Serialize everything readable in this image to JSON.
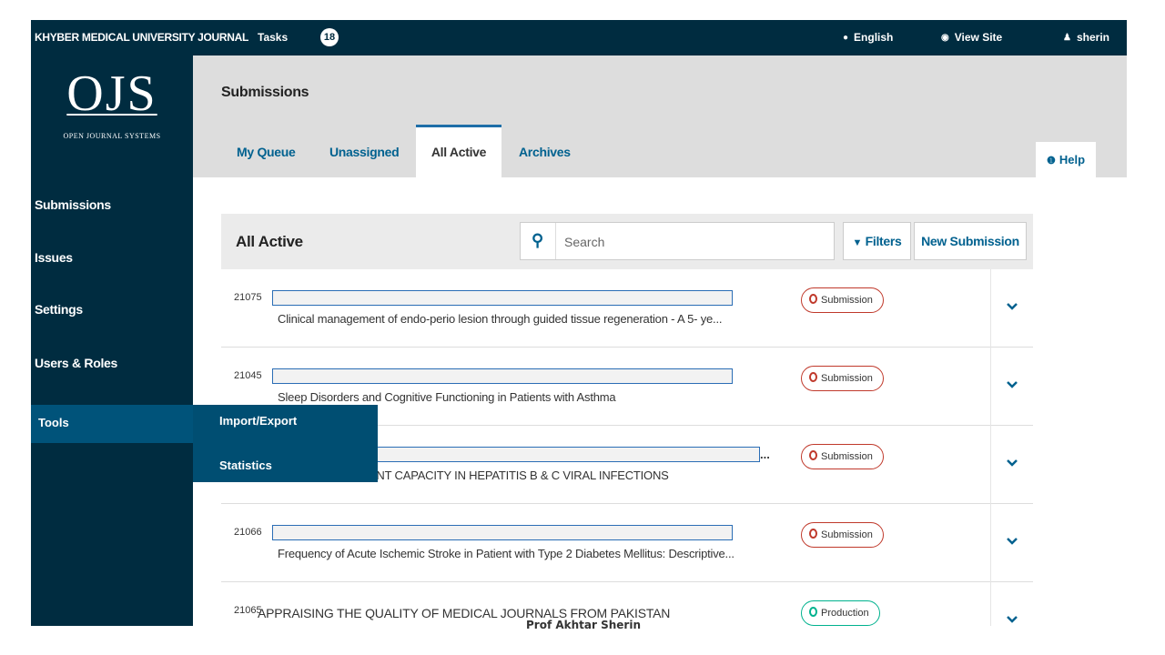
{
  "topbar": {
    "journal": "KHYBER MEDICAL UNIVERSITY JOURNAL",
    "tasks_label": "Tasks",
    "tasks_count": "18",
    "language": "English",
    "view_site": "View Site",
    "user": "sherin"
  },
  "logo": {
    "mark": "OJS",
    "subtitle": "OPEN JOURNAL SYSTEMS"
  },
  "sidebar": {
    "items": [
      {
        "label": "Submissions"
      },
      {
        "label": "Issues"
      },
      {
        "label": "Settings"
      },
      {
        "label": "Users & Roles"
      },
      {
        "label": "Tools"
      }
    ],
    "tools_submenu": [
      "Import/Export",
      "Statistics"
    ]
  },
  "header": {
    "title": "Submissions",
    "tabs": [
      {
        "label": "My Queue"
      },
      {
        "label": "Unassigned"
      },
      {
        "label": "All Active"
      },
      {
        "label": "Archives"
      }
    ],
    "help": "Help"
  },
  "panel": {
    "title": "All Active",
    "search_placeholder": "Search",
    "filters_label": "Filters",
    "new_submission_label": "New Submission"
  },
  "submissions": [
    {
      "id": "21075",
      "title": "Clinical management of endo-perio lesion through guided tissue regeneration - A 5- ye...",
      "stage": "Submission"
    },
    {
      "id": "21045",
      "title": "Sleep Disorders and Cognitive Functioning in Patients with Asthma",
      "stage": "Submission"
    },
    {
      "id": "",
      "title": "ERUM ANTIOXIDANT CAPACITY IN HEPATITIS B & C VIRAL INFECTIONS",
      "stage": "Submission",
      "truncated_marker": "..."
    },
    {
      "id": "21066",
      "title": "Frequency of Acute Ischemic Stroke in Patient with Type 2 Diabetes Mellitus: Descriptive...",
      "stage": "Submission"
    },
    {
      "id": "21065",
      "title": "APPRAISING THE QUALITY OF MEDICAL JOURNALS FROM PAKISTAN",
      "stage": "Production"
    }
  ],
  "footer": {
    "name": "Prof Akhtar Sherin"
  },
  "colors": {
    "navy": "#002c40",
    "tools_highlight": "#00537a",
    "link_blue": "#00618f",
    "submission_red": "#c0392b",
    "production_green": "#00b28e"
  }
}
